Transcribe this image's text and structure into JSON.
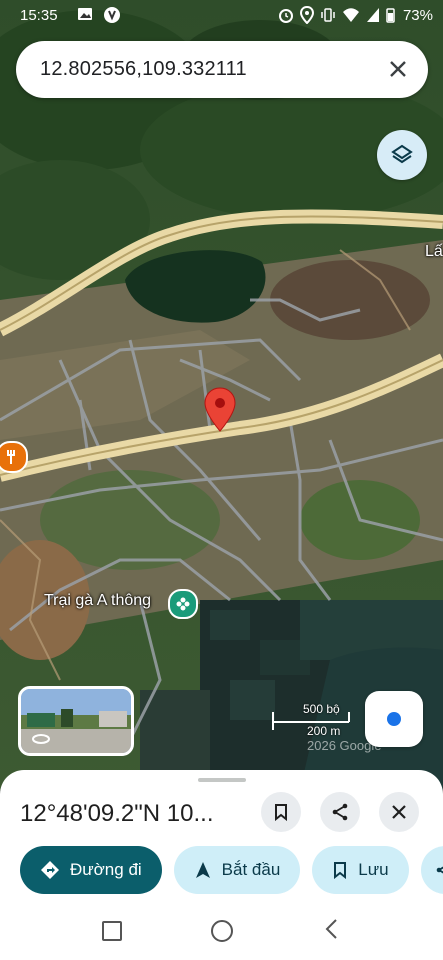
{
  "status_bar": {
    "time": "15:35",
    "battery": "73%",
    "icons": [
      "image-icon",
      "vpn-icon",
      "alarm-icon",
      "location-icon",
      "vibrate-icon",
      "wifi-icon",
      "signal-icon",
      "battery-icon"
    ]
  },
  "search": {
    "query": "12.802556,109.332111",
    "clear_icon": "close-icon"
  },
  "map": {
    "labels": {
      "poi": "Trại gà A thông",
      "place_partial": "Lấ"
    },
    "scale": {
      "top": "500 bộ",
      "bottom": "200 m"
    },
    "watermark": "2026 Google",
    "colors": {
      "pin": "#ea4335",
      "poi_green": "#1a9b7a",
      "food_orange": "#e8710a",
      "my_location": "#1a73e8"
    }
  },
  "sheet": {
    "title": "12°48'09.2\"N 10...",
    "actions": [
      {
        "label": "Đường đi",
        "icon": "directions-icon"
      },
      {
        "label": "Bắt đầu",
        "icon": "navigation-arrow-icon"
      },
      {
        "label": "Lưu",
        "icon": "bookmark-icon"
      },
      {
        "label": "",
        "icon": "share-icon"
      }
    ],
    "accent_color": "#0b5e6b",
    "secondary_color": "#cfeef8"
  }
}
